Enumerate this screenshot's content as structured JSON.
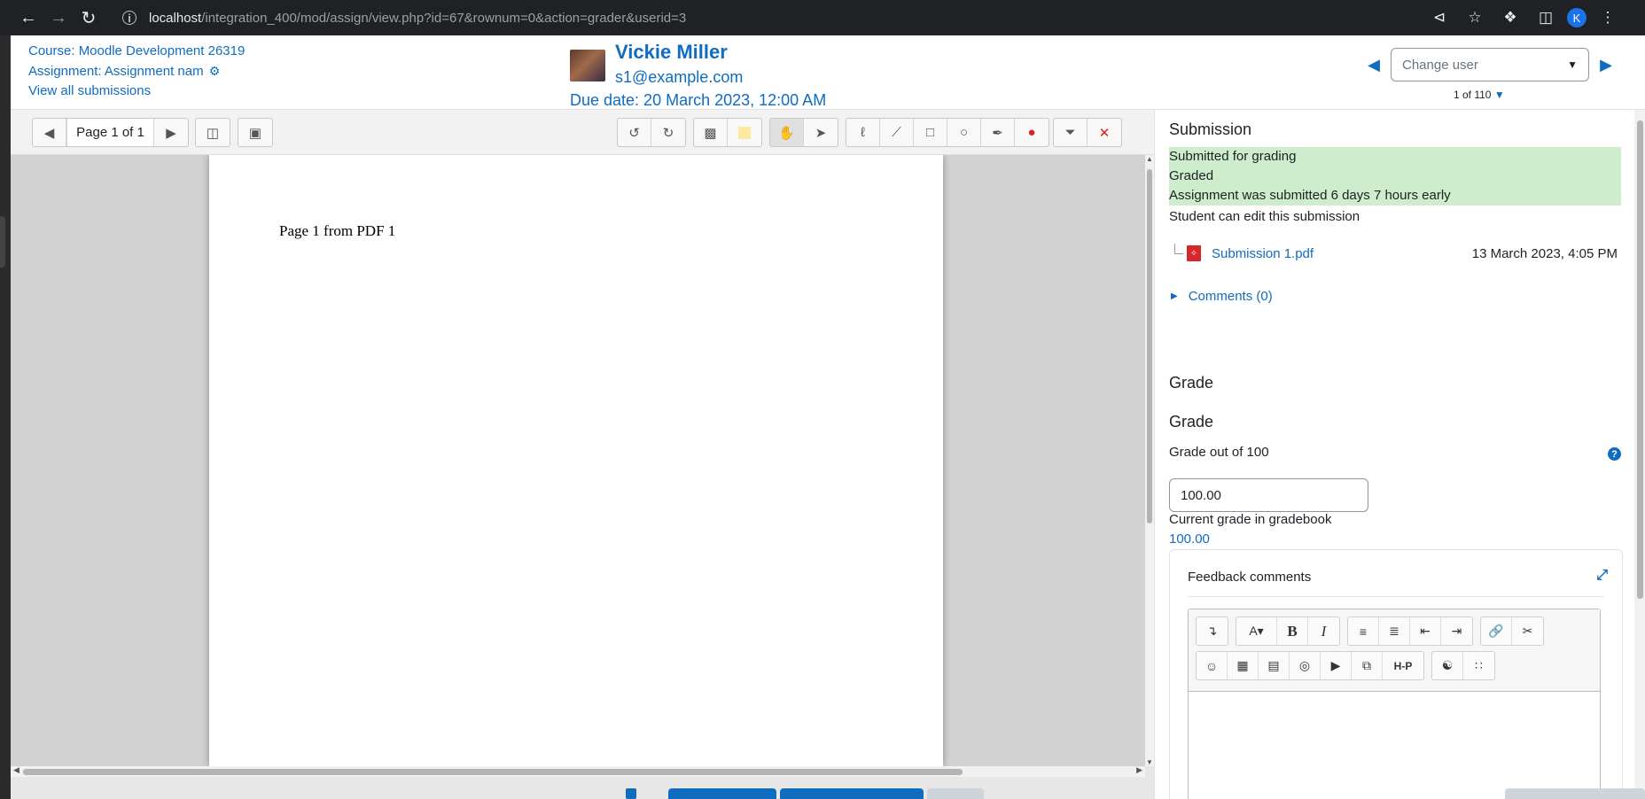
{
  "browser": {
    "url_host": "localhost",
    "url_path": "/integration_400/mod/assign/view.php?id=67&rownum=0&action=grader&userid=3",
    "profile_initial": "K"
  },
  "header": {
    "course": "Course: Moodle Development 26319",
    "assignment": "Assignment: Assignment nam",
    "view_all": "View all submissions",
    "user_name": "Vickie Miller",
    "user_email": "s1@example.com",
    "due_date": "Due date: 20 March 2023, 12:00 AM",
    "change_user_placeholder": "Change user",
    "count": "1 of 110"
  },
  "pdf": {
    "page_label": "Page 1 of 1",
    "page_text": "Page 1 from PDF 1"
  },
  "submission": {
    "title": "Submission",
    "status_lines": [
      "Submitted for grading",
      "Graded",
      "Assignment was submitted 6 days 7 hours early"
    ],
    "can_edit": "Student can edit this submission",
    "file_name": "Submission 1.pdf",
    "file_date": "13 March 2023, 4:05 PM",
    "comments": "Comments (0)"
  },
  "grade": {
    "heading1": "Grade",
    "heading2": "Grade",
    "out_of_label": "Grade out of 100",
    "value": "100.00",
    "current_label": "Current grade in gradebook",
    "current_value": "100.00"
  },
  "feedback": {
    "title": "Feedback comments"
  },
  "colors": {
    "link": "#0f6cbf",
    "status_bg": "#cdedcc",
    "primary_button": "#0f6cbf"
  }
}
